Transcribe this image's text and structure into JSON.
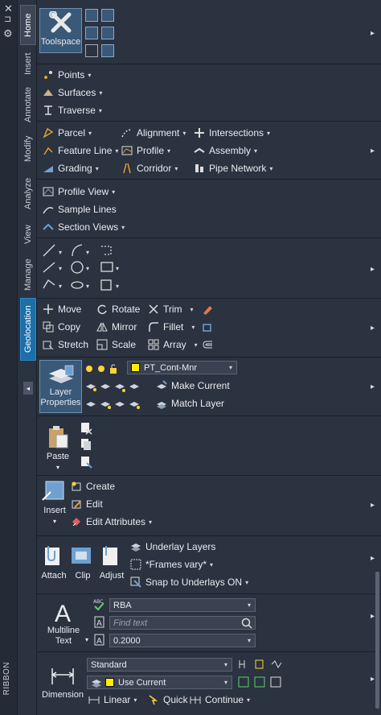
{
  "strip": {
    "close": "✕",
    "dash": "⊐",
    "gear": "⚙",
    "ribbon_label": "RIBBON"
  },
  "tabs": [
    "Home",
    "Insert",
    "Annotate",
    "Modify",
    "Analyze",
    "View",
    "Manage",
    "Geolocation"
  ],
  "tab_arrow": "◂",
  "toolspace": {
    "label": "Toolspace"
  },
  "create_ground": {
    "points": "Points",
    "surfaces": "Surfaces",
    "traverse": "Traverse"
  },
  "create_design": {
    "parcel": "Parcel",
    "alignment": "Alignment",
    "intersections": "Intersections",
    "feature_line": "Feature Line",
    "profile": "Profile",
    "assembly": "Assembly",
    "grading": "Grading",
    "corridor": "Corridor",
    "pipe_network": "Pipe Network"
  },
  "profile_section": {
    "profile_view": "Profile View",
    "sample_lines": "Sample Lines",
    "section_views": "Section Views"
  },
  "modify": {
    "move": "Move",
    "rotate": "Rotate",
    "trim": "Trim",
    "copy": "Copy",
    "mirror": "Mirror",
    "fillet": "Fillet",
    "stretch": "Stretch",
    "scale": "Scale",
    "array": "Array"
  },
  "layers": {
    "layer_properties": "Layer Properties",
    "current_layer": "PT_Cont-Mnr",
    "make_current": "Make Current",
    "match_layer": "Match Layer"
  },
  "clipboard": {
    "paste": "Paste"
  },
  "block": {
    "insert": "Insert",
    "create": "Create",
    "edit": "Edit",
    "edit_attributes": "Edit Attributes"
  },
  "reference": {
    "attach": "Attach",
    "clip": "Clip",
    "adjust": "Adjust",
    "underlay_layers": "Underlay Layers",
    "frames": "*Frames vary*",
    "snap": "Snap to Underlays ON"
  },
  "text": {
    "multiline": "Multiline Text",
    "style": "RBA",
    "find_placeholder": "Find text",
    "height": "0.2000"
  },
  "dimension": {
    "label": "Dimension",
    "style": "Standard",
    "layer": "Use Current",
    "linear": "Linear",
    "quick": "Quick",
    "continue": "Continue"
  },
  "more_arrow": "▸",
  "dropdown_arrow": "▾",
  "colors": {
    "accent": "#1d6faa",
    "panel": "#2b3240",
    "layer_color": "#ffee00"
  }
}
